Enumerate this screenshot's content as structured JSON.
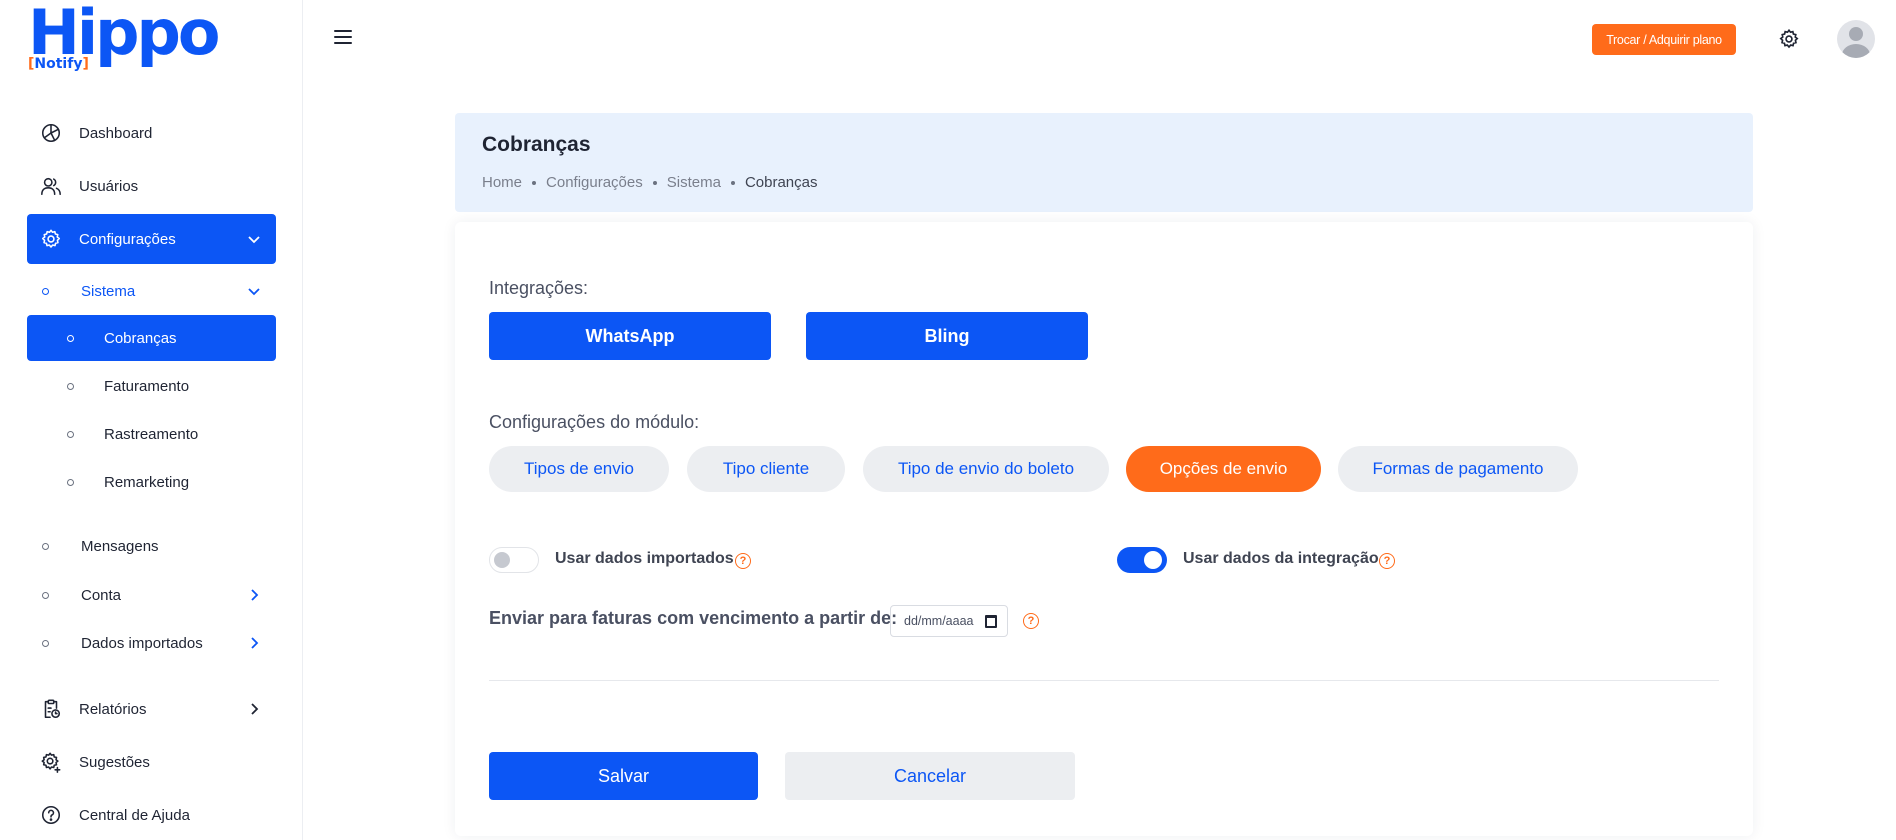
{
  "brand": {
    "name": "Hippo",
    "subtitle": "Notify",
    "subtitle_open": "[",
    "subtitle_close": "]"
  },
  "sidebar": {
    "items": [
      {
        "label": "Dashboard",
        "icon": "dashboard-icon"
      },
      {
        "label": "Usuários",
        "icon": "users-icon"
      },
      {
        "label": "Configurações",
        "icon": "gear-icon",
        "expanded": true
      }
    ],
    "system": {
      "label": "Sistema",
      "expanded": true
    },
    "system_children": [
      {
        "label": "Cobranças",
        "active": true
      },
      {
        "label": "Faturamento"
      },
      {
        "label": "Rastreamento"
      },
      {
        "label": "Remarketing"
      }
    ],
    "config_children": [
      {
        "label": "Mensagens"
      },
      {
        "label": "Conta"
      },
      {
        "label": "Dados importados"
      }
    ],
    "bottom_items": [
      {
        "label": "Relatórios",
        "icon": "report-icon"
      },
      {
        "label": "Sugestões",
        "icon": "settings-plus-icon"
      },
      {
        "label": "Central de Ajuda",
        "icon": "help-circle-icon"
      }
    ]
  },
  "topbar": {
    "plan_button": "Trocar / Adquirir plano"
  },
  "header": {
    "title": "Cobranças",
    "breadcrumb": [
      "Home",
      "Configurações",
      "Sistema",
      "Cobranças"
    ]
  },
  "content": {
    "integrations_label": "Integrações:",
    "integrations": [
      "WhatsApp",
      "Bling"
    ],
    "module_label": "Configurações do módulo:",
    "module_tabs": [
      "Tipos de envio",
      "Tipo cliente",
      "Tipo de envio do boleto",
      "Opções de envio",
      "Formas de pagamento"
    ],
    "active_tab": "Opções de envio",
    "options": [
      {
        "label": "Usar dados importados",
        "enabled": false
      },
      {
        "label": "Usar dados da integração",
        "enabled": true
      }
    ],
    "date_label": "Enviar para faturas com vencimento a partir de:",
    "date_placeholder": "dd/mm/aaaa",
    "help_glyph": "?",
    "save_label": "Salvar",
    "cancel_label": "Cancelar"
  },
  "colors": {
    "primary": "#0c56f5",
    "accent": "#ff6b1a",
    "header_bg": "#e8f1fd",
    "pill_bg": "#eceef1"
  }
}
